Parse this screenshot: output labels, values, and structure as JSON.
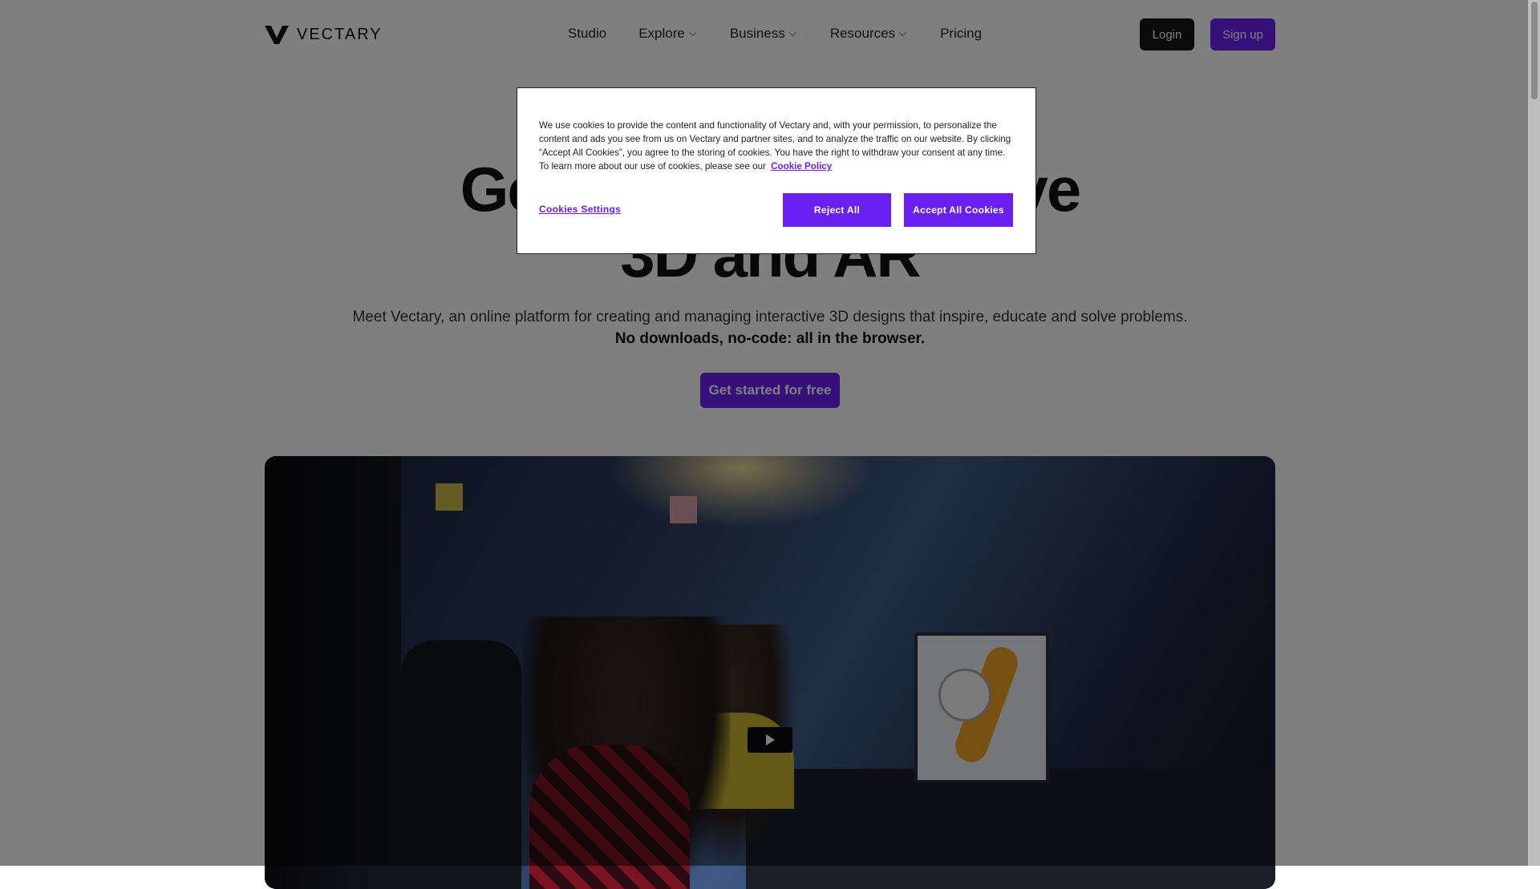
{
  "brand": {
    "name": "VECTARY",
    "accent": "#6a20f0"
  },
  "nav": {
    "items": [
      {
        "label": "Studio",
        "has_dropdown": false
      },
      {
        "label": "Explore",
        "has_dropdown": true
      },
      {
        "label": "Business",
        "has_dropdown": true
      },
      {
        "label": "Resources",
        "has_dropdown": true
      },
      {
        "label": "Pricing",
        "has_dropdown": false
      }
    ],
    "login": "Login",
    "signup": "Sign up"
  },
  "hero": {
    "title_line1_left": "Get th",
    "title_line1_right": "active",
    "title_line2": "3D and AR",
    "subtitle": "Meet Vectary, an online platform for creating and managing interactive 3D designs that inspire, educate and solve problems.",
    "subtitle_bold": "No downloads, no-code: all in the browser.",
    "cta": "Get started for free"
  },
  "video": {
    "play_icon": "play-icon"
  },
  "cookie": {
    "text": "We use cookies to provide the content and functionality of Vectary and, with your permission, to personalize the content and ads you see from us on Vectary and partner sites, and to analyze the traffic on our website. By clicking “Accept All Cookies”, you agree to the storing of cookies. You have the right to withdraw your consent at any time. To learn more about our use of cookies, please see our",
    "policy_link": "Cookie Policy",
    "settings": "Cookies Settings",
    "reject": "Reject All",
    "accept": "Accept All Cookies"
  }
}
